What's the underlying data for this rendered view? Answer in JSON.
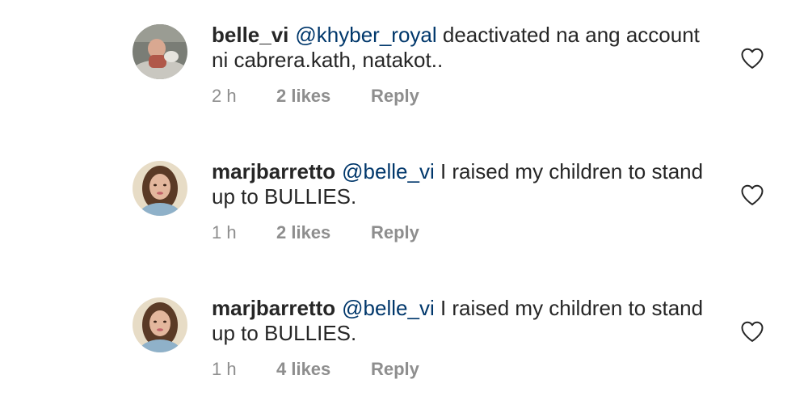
{
  "comments": [
    {
      "username": "belle_vi",
      "mention": "@khyber_royal",
      "text": " deactivated na ang account ni cabrera.kath, natakot..",
      "time": "2 h",
      "likes": "2 likes",
      "reply": "Reply",
      "like_icon": "heart-outline-icon"
    },
    {
      "username": "marjbarretto",
      "mention": "@belle_vi",
      "text": " I raised my children to stand up to BULLIES.",
      "time": "1 h",
      "likes": "2 likes",
      "reply": "Reply",
      "like_icon": "heart-outline-icon"
    },
    {
      "username": "marjbarretto",
      "mention": "@belle_vi",
      "text": " I raised my children to stand up to BULLIES.",
      "time": "1 h",
      "likes": "4 likes",
      "reply": "Reply",
      "like_icon": "heart-outline-icon"
    }
  ],
  "colors": {
    "text": "#262626",
    "mention": "#00376b",
    "meta": "#8e8e8e"
  }
}
